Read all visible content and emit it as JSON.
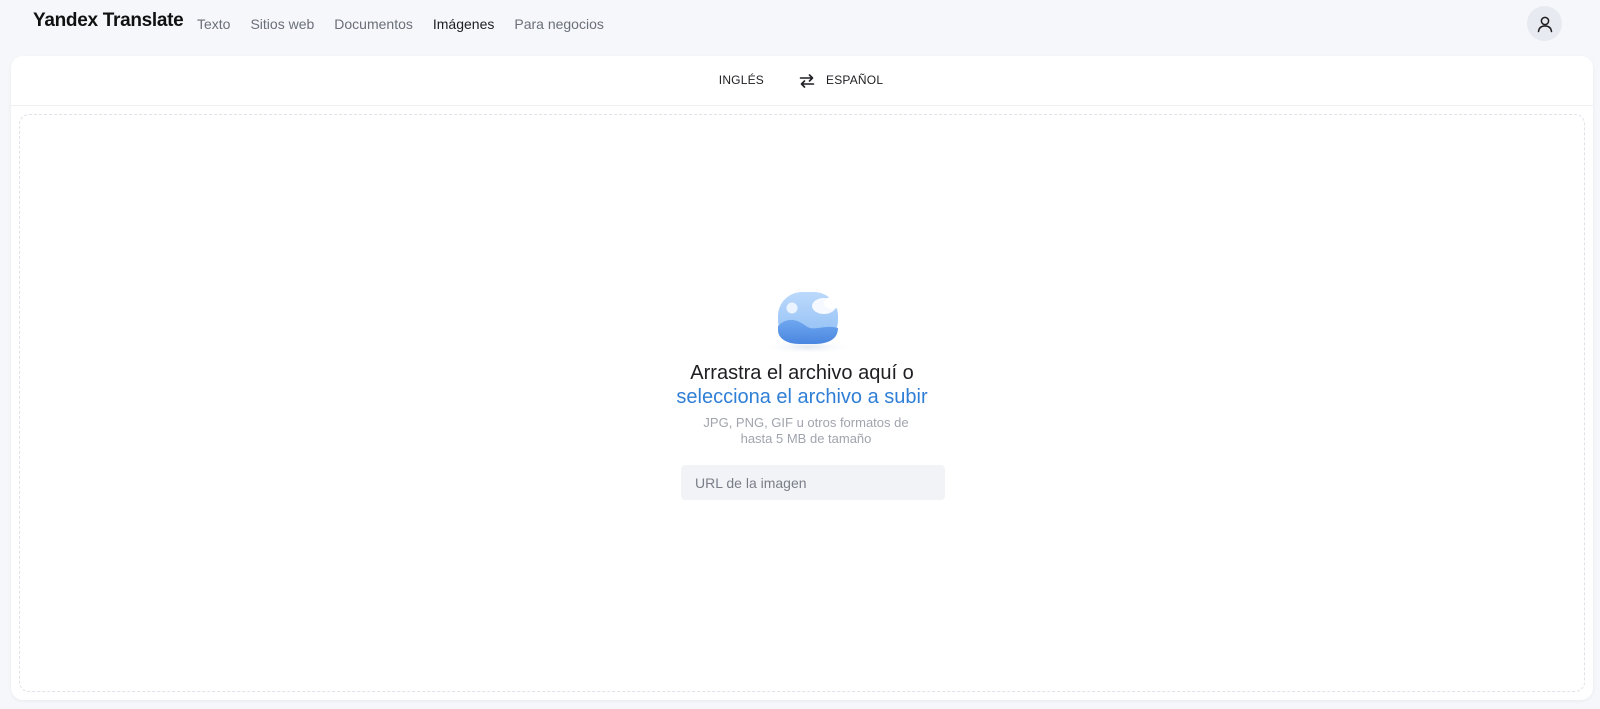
{
  "header": {
    "brand": "Yandex Translate",
    "nav": [
      {
        "label": "Texto",
        "active": false
      },
      {
        "label": "Sitios web",
        "active": false
      },
      {
        "label": "Documentos",
        "active": false
      },
      {
        "label": "Imágenes",
        "active": true
      },
      {
        "label": "Para negocios",
        "active": false
      }
    ],
    "avatar_icon": "user-icon"
  },
  "languages": {
    "source": "INGLÉS",
    "target": "ESPAÑOL",
    "swap_icon": "swap-arrows-icon"
  },
  "upload": {
    "illustration_icon": "image-icon",
    "title_line1": "Arrastra el archivo aquí o",
    "title_link": "selecciona el archivo a subir",
    "hint": "JPG, PNG, GIF u otros formatos de hasta 5 MB de tamaño",
    "url_placeholder": "URL de la imagen",
    "url_value": ""
  },
  "colors": {
    "accent": "#2f7fd6",
    "background": "#f5f7fa",
    "card": "#ffffff"
  }
}
